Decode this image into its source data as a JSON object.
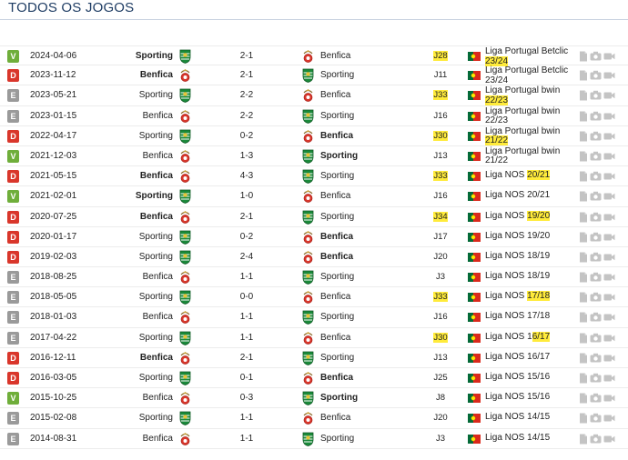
{
  "header": {
    "title": "TODOS OS JOGOS"
  },
  "colors": {
    "V": "#6fae3a",
    "D": "#d9362b",
    "E": "#9a9a9a",
    "highlight": "#ffeb3b"
  },
  "icons": [
    "document-icon",
    "camera-icon",
    "video-icon"
  ],
  "matches": [
    {
      "result": "V",
      "date": "2024-04-06",
      "home": "Sporting",
      "home_bold": true,
      "score": "2-1",
      "away": "Benfica",
      "away_bold": false,
      "round": "J28",
      "round_hl": true,
      "comp_a": "Liga Portugal Betclic ",
      "comp_b": "23/24",
      "comp_b_hl": true,
      "two_line": true
    },
    {
      "result": "D",
      "date": "2023-11-12",
      "home": "Benfica",
      "home_bold": true,
      "score": "2-1",
      "away": "Sporting",
      "away_bold": false,
      "round": "J11",
      "round_hl": false,
      "comp_a": "Liga Portugal Betclic 23/24",
      "comp_b": "",
      "comp_b_hl": false,
      "two_line": true
    },
    {
      "result": "E",
      "date": "2023-05-21",
      "home": "Sporting",
      "home_bold": false,
      "score": "2-2",
      "away": "Benfica",
      "away_bold": false,
      "round": "J33",
      "round_hl": true,
      "comp_a": "Liga Portugal bwin ",
      "comp_b": "22/23",
      "comp_b_hl": true,
      "two_line": true
    },
    {
      "result": "E",
      "date": "2023-01-15",
      "home": "Benfica",
      "home_bold": false,
      "score": "2-2",
      "away": "Sporting",
      "away_bold": false,
      "round": "J16",
      "round_hl": false,
      "comp_a": "Liga Portugal bwin 22/23",
      "comp_b": "",
      "comp_b_hl": false,
      "two_line": true
    },
    {
      "result": "D",
      "date": "2022-04-17",
      "home": "Sporting",
      "home_bold": false,
      "score": "0-2",
      "away": "Benfica",
      "away_bold": true,
      "round": "J30",
      "round_hl": true,
      "comp_a": "Liga Portugal bwin ",
      "comp_b": "21/22",
      "comp_b_hl": true,
      "two_line": true
    },
    {
      "result": "V",
      "date": "2021-12-03",
      "home": "Benfica",
      "home_bold": false,
      "score": "1-3",
      "away": "Sporting",
      "away_bold": true,
      "round": "J13",
      "round_hl": false,
      "comp_a": "Liga Portugal bwin 21/22",
      "comp_b": "",
      "comp_b_hl": false,
      "two_line": true
    },
    {
      "result": "D",
      "date": "2021-05-15",
      "home": "Benfica",
      "home_bold": true,
      "score": "4-3",
      "away": "Sporting",
      "away_bold": false,
      "round": "J33",
      "round_hl": true,
      "comp_a": "Liga NOS ",
      "comp_b": "20/21",
      "comp_b_hl": true,
      "two_line": false
    },
    {
      "result": "V",
      "date": "2021-02-01",
      "home": "Sporting",
      "home_bold": true,
      "score": "1-0",
      "away": "Benfica",
      "away_bold": false,
      "round": "J16",
      "round_hl": false,
      "comp_a": "Liga NOS 20/21",
      "comp_b": "",
      "comp_b_hl": false,
      "two_line": false
    },
    {
      "result": "D",
      "date": "2020-07-25",
      "home": "Benfica",
      "home_bold": true,
      "score": "2-1",
      "away": "Sporting",
      "away_bold": false,
      "round": "J34",
      "round_hl": true,
      "comp_a": "Liga NOS ",
      "comp_b": "19/20",
      "comp_b_hl": true,
      "two_line": false
    },
    {
      "result": "D",
      "date": "2020-01-17",
      "home": "Sporting",
      "home_bold": false,
      "score": "0-2",
      "away": "Benfica",
      "away_bold": true,
      "round": "J17",
      "round_hl": false,
      "comp_a": "Liga NOS 19/20",
      "comp_b": "",
      "comp_b_hl": false,
      "two_line": false
    },
    {
      "result": "D",
      "date": "2019-02-03",
      "home": "Sporting",
      "home_bold": false,
      "score": "2-4",
      "away": "Benfica",
      "away_bold": true,
      "round": "J20",
      "round_hl": false,
      "comp_a": "Liga NOS 18/19",
      "comp_b": "",
      "comp_b_hl": false,
      "two_line": false
    },
    {
      "result": "E",
      "date": "2018-08-25",
      "home": "Benfica",
      "home_bold": false,
      "score": "1-1",
      "away": "Sporting",
      "away_bold": false,
      "round": "J3",
      "round_hl": false,
      "comp_a": "Liga NOS 18/19",
      "comp_b": "",
      "comp_b_hl": false,
      "two_line": false
    },
    {
      "result": "E",
      "date": "2018-05-05",
      "home": "Sporting",
      "home_bold": false,
      "score": "0-0",
      "away": "Benfica",
      "away_bold": false,
      "round": "J33",
      "round_hl": true,
      "comp_a": "Liga NOS ",
      "comp_b": "17/18",
      "comp_b_hl": true,
      "two_line": false
    },
    {
      "result": "E",
      "date": "2018-01-03",
      "home": "Benfica",
      "home_bold": false,
      "score": "1-1",
      "away": "Sporting",
      "away_bold": false,
      "round": "J16",
      "round_hl": false,
      "comp_a": "Liga NOS 17/18",
      "comp_b": "",
      "comp_b_hl": false,
      "two_line": false
    },
    {
      "result": "E",
      "date": "2017-04-22",
      "home": "Sporting",
      "home_bold": false,
      "score": "1-1",
      "away": "Benfica",
      "away_bold": false,
      "round": "J30",
      "round_hl": true,
      "comp_a": "Liga NOS 1",
      "comp_b": "6/17",
      "comp_b_hl": true,
      "two_line": false
    },
    {
      "result": "D",
      "date": "2016-12-11",
      "home": "Benfica",
      "home_bold": true,
      "score": "2-1",
      "away": "Sporting",
      "away_bold": false,
      "round": "J13",
      "round_hl": false,
      "comp_a": "Liga NOS 16/17",
      "comp_b": "",
      "comp_b_hl": false,
      "two_line": false
    },
    {
      "result": "D",
      "date": "2016-03-05",
      "home": "Sporting",
      "home_bold": false,
      "score": "0-1",
      "away": "Benfica",
      "away_bold": true,
      "round": "J25",
      "round_hl": false,
      "comp_a": "Liga NOS 15/16",
      "comp_b": "",
      "comp_b_hl": false,
      "two_line": false
    },
    {
      "result": "V",
      "date": "2015-10-25",
      "home": "Benfica",
      "home_bold": false,
      "score": "0-3",
      "away": "Sporting",
      "away_bold": true,
      "round": "J8",
      "round_hl": false,
      "comp_a": "Liga NOS 15/16",
      "comp_b": "",
      "comp_b_hl": false,
      "two_line": false
    },
    {
      "result": "E",
      "date": "2015-02-08",
      "home": "Sporting",
      "home_bold": false,
      "score": "1-1",
      "away": "Benfica",
      "away_bold": false,
      "round": "J20",
      "round_hl": false,
      "comp_a": "Liga NOS 14/15",
      "comp_b": "",
      "comp_b_hl": false,
      "two_line": false
    },
    {
      "result": "E",
      "date": "2014-08-31",
      "home": "Benfica",
      "home_bold": false,
      "score": "1-1",
      "away": "Sporting",
      "away_bold": false,
      "round": "J3",
      "round_hl": false,
      "comp_a": "Liga NOS 14/15",
      "comp_b": "",
      "comp_b_hl": false,
      "two_line": false
    }
  ]
}
